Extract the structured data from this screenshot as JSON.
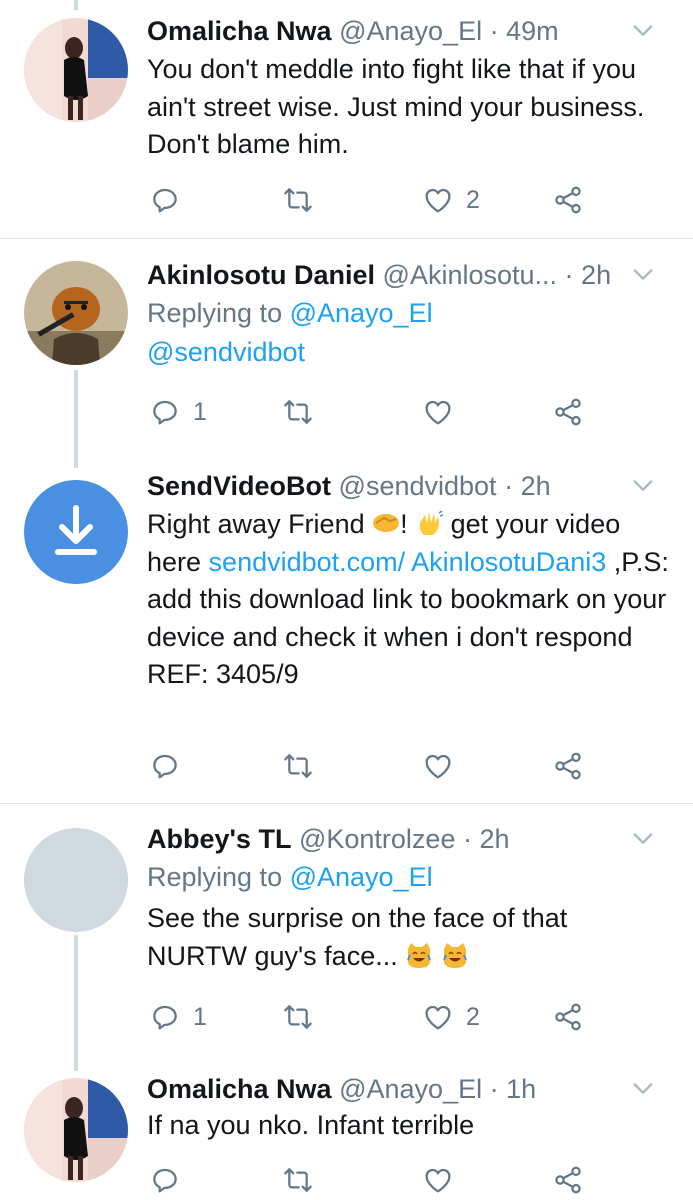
{
  "tweets": [
    {
      "name": "Omalicha Nwa",
      "handle": "@Anayo_El",
      "sep": " · ",
      "time": "49m",
      "body": "You don't meddle into fight like that if you ain't street wise. Just mind your business. Don't blame him.",
      "replies": "",
      "likes": "2"
    },
    {
      "name": "Akinlosotu Daniel",
      "handle": "@Akinlosotu...",
      "sep": " · ",
      "time": "2h",
      "replying_label": "Replying to ",
      "replying_to": "@Anayo_El",
      "mention": "@sendvidbot",
      "replies": "1",
      "likes": ""
    },
    {
      "name": "SendVideoBot",
      "handle": "@sendvidbot",
      "sep": " · ",
      "time": "2h",
      "body_pre": "Right away Friend ",
      "body_mid": "! ",
      "body_mid2": " get your video here ",
      "link": "sendvidbot.com/ AkinlosotuDani3",
      "body_post": " ,P.S: add this download link to bookmark on your device and check it when i don't respond REF: 3405/9",
      "replies": "",
      "likes": ""
    },
    {
      "name": "Abbey's TL",
      "handle": "@Kontrolzee",
      "sep": " · ",
      "time": "2h",
      "replying_label": "Replying to ",
      "replying_to": "@Anayo_El",
      "body": "See the surprise on the face of that NURTW guy's face... ",
      "replies": "1",
      "likes": "2"
    },
    {
      "name": "Omalicha Nwa",
      "handle": "@Anayo_El",
      "sep": " · ",
      "time": "1h",
      "body": "If na you nko. Infant terrible",
      "replies": "",
      "likes": ""
    }
  ],
  "icons": {
    "reply": "reply-icon",
    "retweet": "retweet-icon",
    "like": "heart-icon",
    "share": "share-icon",
    "more": "chevron-down-icon",
    "download": "download-icon"
  },
  "colors": {
    "link": "#1da1f2",
    "muted": "#657786",
    "divider": "#e1e8ed",
    "bot_avatar": "#4a90e2"
  }
}
